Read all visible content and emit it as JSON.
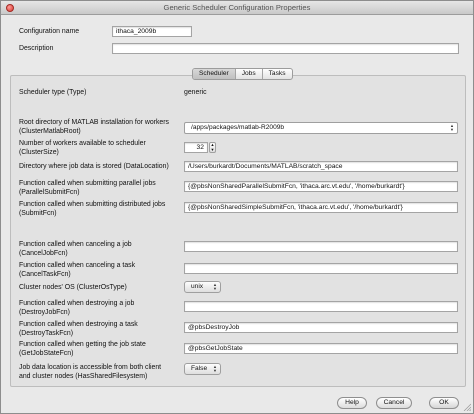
{
  "window": {
    "title": "Generic Scheduler Configuration Properties"
  },
  "config_name": {
    "label": "Configuration name",
    "value": "ithaca_2009b"
  },
  "description": {
    "label": "Description",
    "value": ""
  },
  "tabs": [
    {
      "label": "Scheduler"
    },
    {
      "label": "Jobs"
    },
    {
      "label": "Tasks"
    }
  ],
  "scheduler": {
    "type_label": "Scheduler type (Type)",
    "type_value": "generic",
    "matlab_root_label1": "Root directory of MATLAB installation for workers",
    "matlab_root_label2": "(ClusterMatlabRoot)",
    "matlab_root_value": "/apps/packages/matlab-R2009b",
    "cluster_size_label1": "Number of workers available to scheduler",
    "cluster_size_label2": "(ClusterSize)",
    "cluster_size_value": "32",
    "data_location_label": "Directory where job data is stored (DataLocation)",
    "data_location_value": "/Users/burkardt/Documents/MATLAB/scratch_space",
    "parallel_submit_label1": "Function called when submitting parallel jobs",
    "parallel_submit_label2": "(ParallelSubmitFcn)",
    "parallel_submit_value": "{@pbsNonSharedParallelSubmitFcn, 'ithaca.arc.vt.edu', '/home/burkardt'}",
    "submit_label1": "Function called when submitting distributed jobs",
    "submit_label2": "(SubmitFcn)",
    "submit_value": "{@pbsNonSharedSimpleSubmitFcn, 'ithaca.arc.vt.edu', '/home/burkardt'}",
    "cancel_job_label1": "Function called when canceling a job",
    "cancel_job_label2": "(CancelJobFcn)",
    "cancel_job_value": "",
    "cancel_task_label1": "Function called when canceling a task",
    "cancel_task_label2": "(CancelTaskFcn)",
    "cancel_task_value": "",
    "os_label": "Cluster nodes' OS (ClusterOsType)",
    "os_value": "unix",
    "destroy_job_label1": "Function called when destroying a job",
    "destroy_job_label2": "(DestroyJobFcn)",
    "destroy_job_value": "",
    "destroy_task_label1": "Function called when destroying a task",
    "destroy_task_label2": "(DestroyTaskFcn)",
    "destroy_task_value": "@pbsDestroyJob",
    "get_state_label1": "Function called when getting the job state",
    "get_state_label2": "(GetJobStateFcn)",
    "get_state_value": "@pbsGetJobState",
    "shared_fs_label1": "Job data location is accessible from both client",
    "shared_fs_label2": "and cluster nodes (HasSharedFilesystem)",
    "shared_fs_value": "False"
  },
  "buttons": {
    "help": "Help",
    "cancel": "Cancel",
    "ok": "OK"
  },
  "icons": {
    "close": "close-icon",
    "dropdown": "dropdown-arrows-icon",
    "stepper": "stepper-arrows-icon",
    "resize": "resize-grip-icon"
  }
}
